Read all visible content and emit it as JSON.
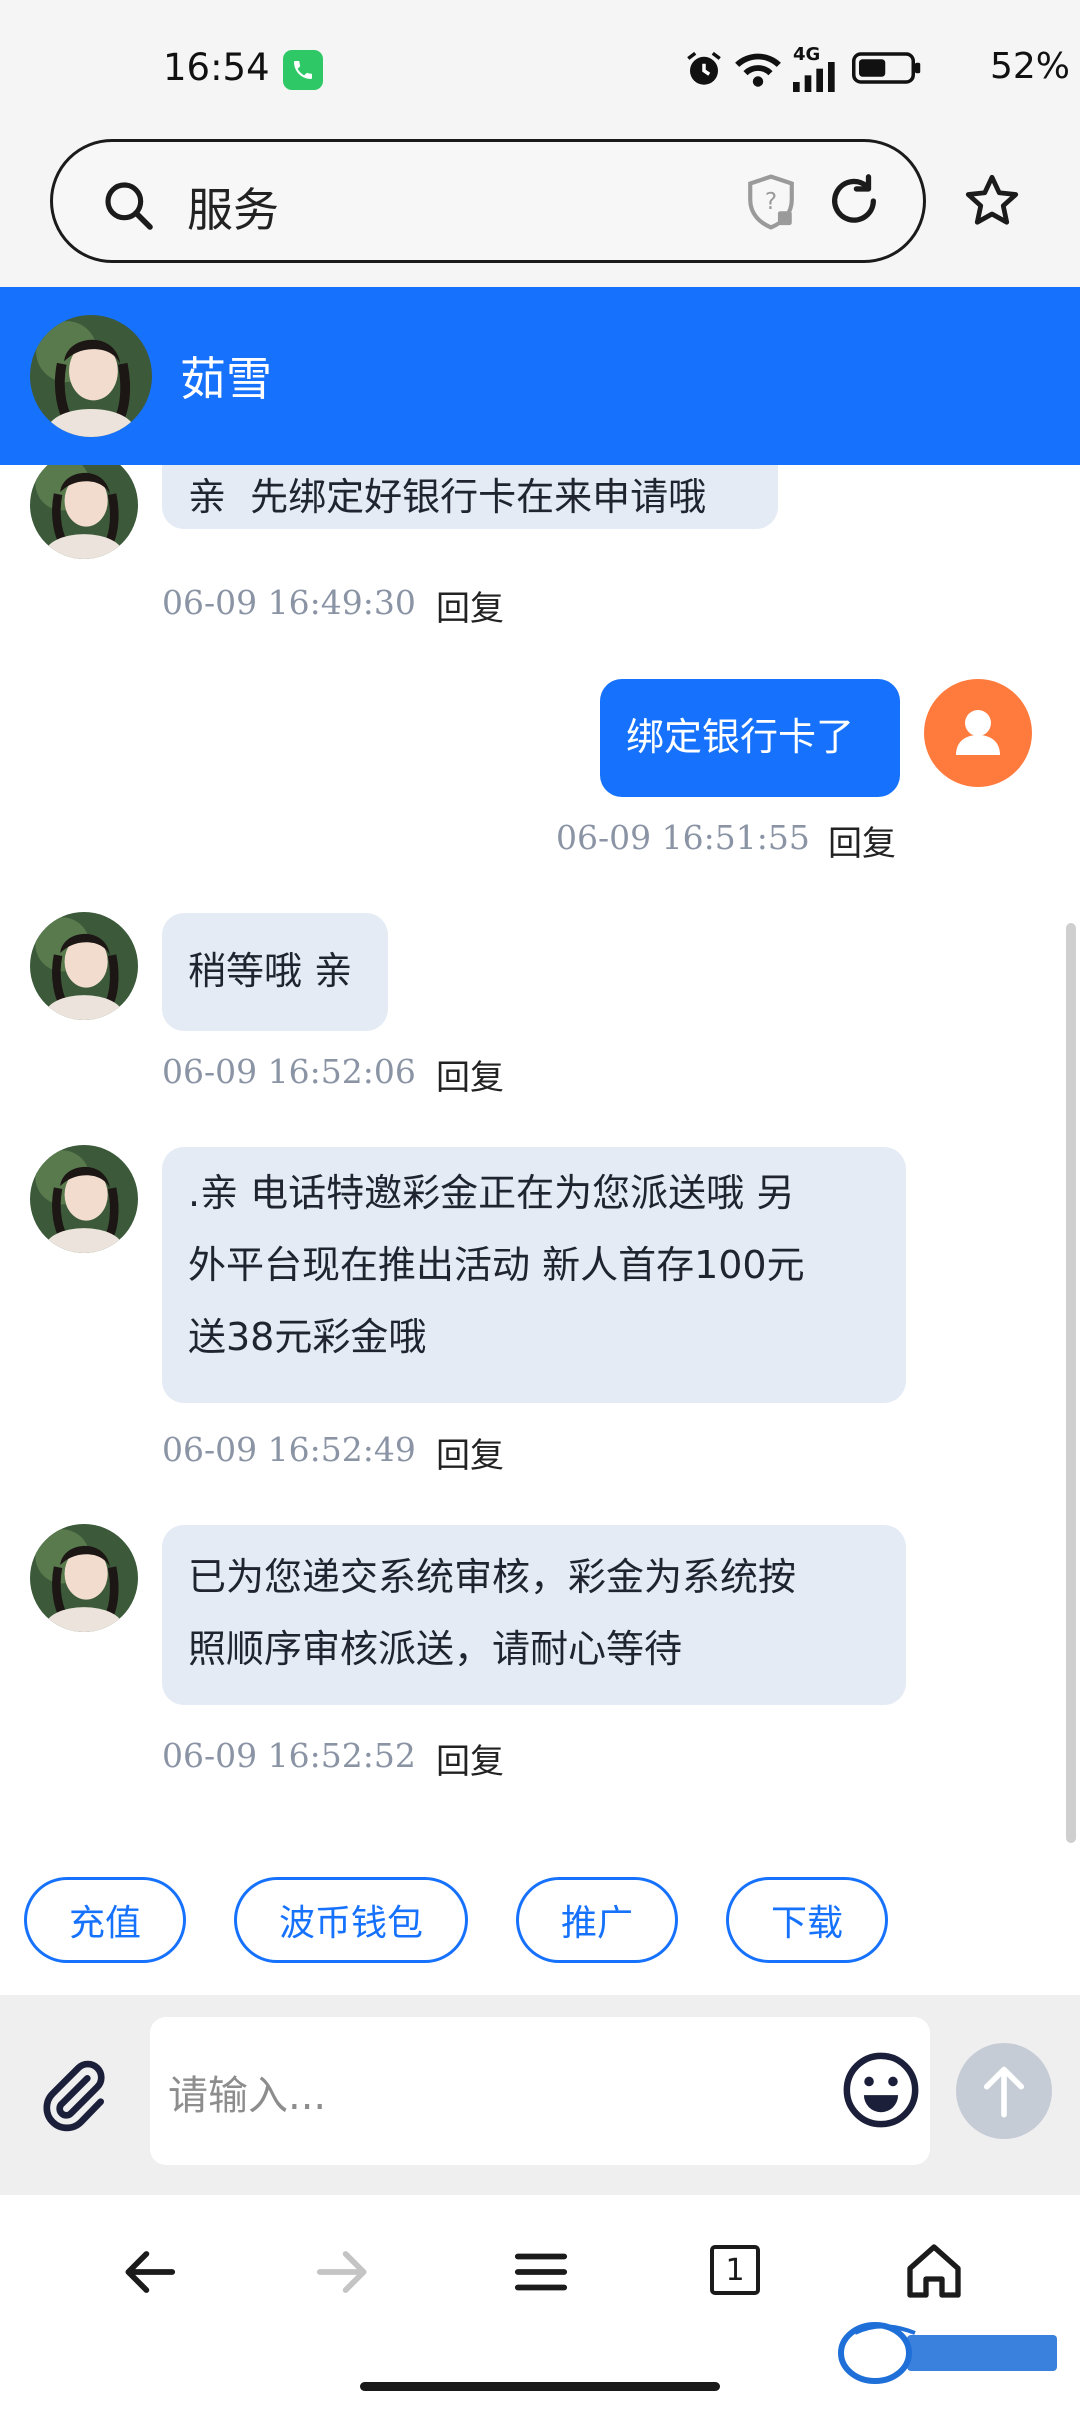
{
  "status_bar": {
    "time": "16:54",
    "network": "4G",
    "battery": "52%",
    "icons": [
      "phone-call-icon",
      "alarm-icon",
      "wifi-icon",
      "signal-icon",
      "battery-icon"
    ]
  },
  "browser": {
    "address_text": "服务",
    "icons": [
      "search-icon",
      "shield-icon",
      "refresh-icon",
      "star-icon"
    ]
  },
  "chat": {
    "contact_name": "茹雪",
    "messages": [
      {
        "side": "in",
        "text": "亲  先绑定好银行卡在来申请哦",
        "time": "06-09 16:49:30",
        "reply": "回复"
      },
      {
        "side": "out",
        "text": "绑定银行卡了",
        "time": "06-09 16:51:55",
        "reply": "回复"
      },
      {
        "side": "in",
        "text": "稍等哦 亲",
        "time": "06-09 16:52:06",
        "reply": "回复"
      },
      {
        "side": "in",
        "lines": [
          ".亲 电话特邀彩金正在为您派送哦 另",
          "外平台现在推出活动 新人首存100元",
          "送38元彩金哦"
        ],
        "time": "06-09 16:52:49",
        "reply": "回复"
      },
      {
        "side": "in",
        "lines": [
          "已为您递交系统审核，彩金为系统按",
          "照顺序审核派送，请耐心等待"
        ],
        "time": "06-09 16:52:52",
        "reply": "回复"
      }
    ]
  },
  "quick_actions": [
    "充值",
    "波币钱包",
    "推广",
    "下载"
  ],
  "input": {
    "placeholder": "请输入...",
    "icons": [
      "attachment-icon",
      "emoji-icon",
      "send-icon"
    ]
  },
  "nav": {
    "tab_count": "1",
    "icons": [
      "back-icon",
      "forward-icon",
      "menu-icon",
      "tabs-icon",
      "home-icon"
    ]
  },
  "colors": {
    "accent": "#1672fd",
    "bubble_in": "#e4ebf5",
    "user_avatar": "#ff7a3d"
  }
}
